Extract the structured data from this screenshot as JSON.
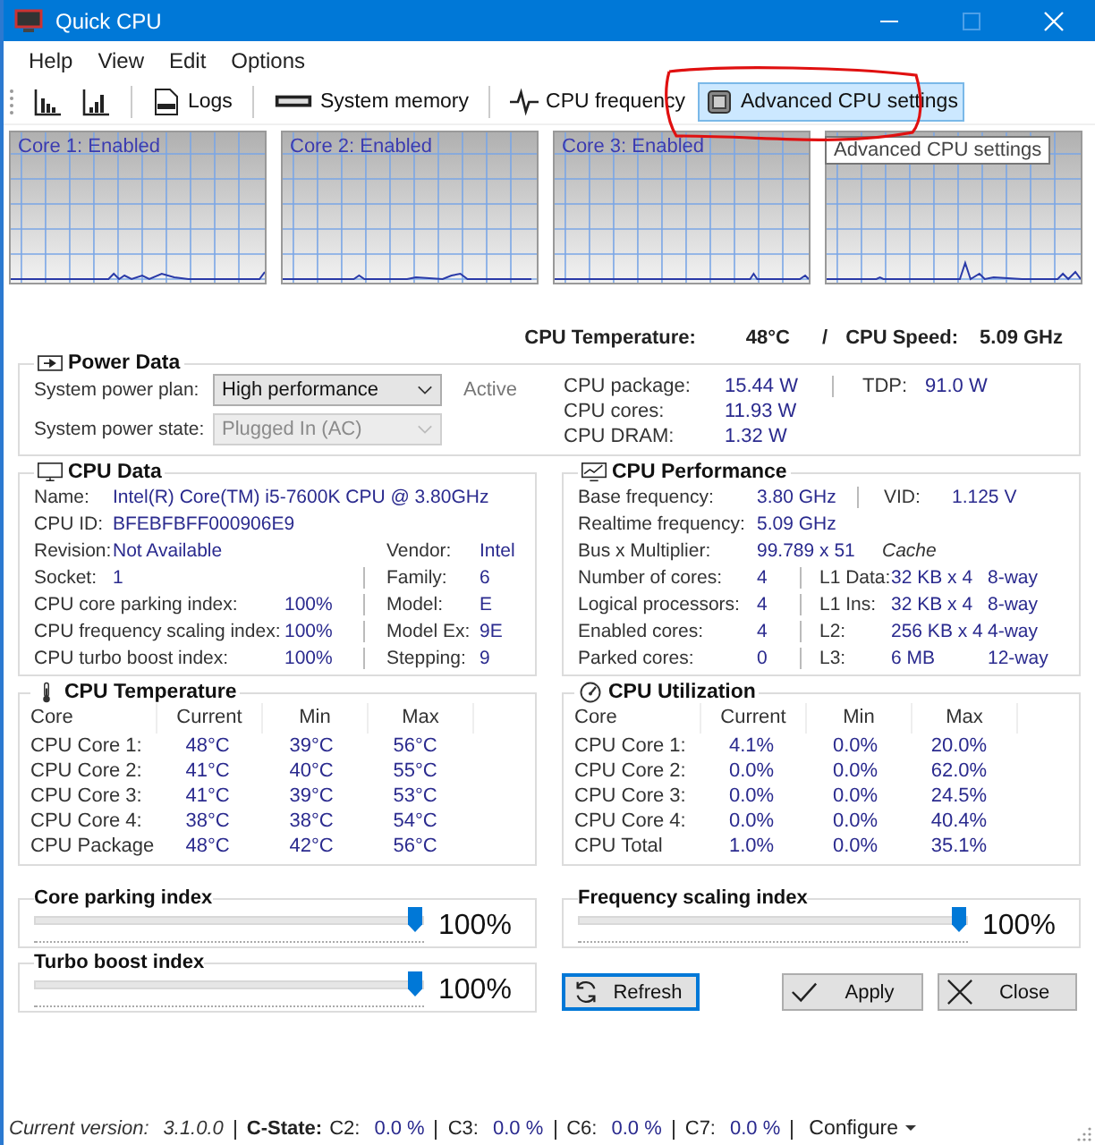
{
  "window": {
    "title": "Quick CPU"
  },
  "menu": [
    {
      "label": "Help"
    },
    {
      "label": "View"
    },
    {
      "label": "Edit"
    },
    {
      "label": "Options"
    }
  ],
  "toolbar": [
    {
      "kind": "bars",
      "selected": false
    },
    {
      "kind": "rising",
      "selected": false
    },
    {
      "kind": "sep"
    },
    {
      "kind": "log",
      "label": "Logs",
      "selected": false
    },
    {
      "kind": "sep"
    },
    {
      "kind": "memory",
      "label": "System memory",
      "selected": false
    },
    {
      "kind": "sep"
    },
    {
      "kind": "pulse",
      "label": "CPU frequency",
      "selected": false
    },
    {
      "kind": "chip",
      "label": "Advanced CPU settings",
      "selected": true
    }
  ],
  "graphs": [
    {
      "kind": "labeled",
      "label": "Core 1: Enabled"
    },
    {
      "kind": "labeled",
      "label": "Core 2: Enabled"
    },
    {
      "kind": "labeled",
      "label": "Core 3: Enabled"
    },
    {
      "kind": "plain"
    }
  ],
  "tooltip": "Advanced CPU settings",
  "summary": {
    "temperature_label": "CPU Temperature:",
    "temperature": "48°C",
    "separator": "/",
    "speed_label": "CPU Speed:",
    "speed": "5.09 GHz"
  },
  "power": {
    "title": "Power Data",
    "selects": [
      {
        "label": "System power plan:",
        "value": "High performance",
        "disabled": false,
        "status": "Active"
      },
      {
        "label": "System power state:",
        "value": "Plugged In (AC)",
        "disabled": true
      }
    ],
    "rows": [
      {
        "label": "CPU package:",
        "value": "15.44 W"
      },
      {
        "label": "CPU cores:",
        "value": "11.93 W"
      },
      {
        "label": "CPU DRAM:",
        "value": "1.32 W"
      }
    ],
    "tdp_label": "TDP:",
    "tdp": "91.0 W"
  },
  "cpu_data": {
    "title": "CPU Data",
    "rows": [
      {
        "kind": "wide",
        "label": "Name:",
        "value": "Intel(R) Core(TM) i5-7600K CPU @ 3.80GHz"
      },
      {
        "kind": "wide",
        "label": "CPU ID:",
        "value": "BFEBFBFF000906E9"
      },
      {
        "kind": "pair",
        "label": "Revision:",
        "value": "Not Available",
        "label2": "Vendor:",
        "value2": "Intel"
      },
      {
        "kind": "split",
        "label": "Socket:",
        "value": "1",
        "label2": "Family:",
        "value2": "6"
      },
      {
        "kind": "far",
        "label": "CPU core parking index:",
        "value": "100%",
        "label2": "Model:",
        "value2": "E"
      },
      {
        "kind": "far",
        "label": "CPU frequency scaling index:",
        "value": "100%",
        "label2": "Model Ex:",
        "value2": "9E"
      },
      {
        "kind": "far",
        "label": "CPU turbo boost index:",
        "value": "100%",
        "label2": "Stepping:",
        "value2": "9"
      }
    ]
  },
  "cpu_performance": {
    "title": "CPU Performance",
    "rows": [
      {
        "label": "Base frequency:",
        "value": "3.80 GHz",
        "label2": "VID:",
        "value2": "1.125 V"
      },
      {
        "label": "Realtime frequency:",
        "value": "5.09 GHz"
      },
      {
        "label": "Bus x Multiplier:",
        "value": "99.789 x 51"
      }
    ],
    "cache_title": "Cache",
    "cache_rows": [
      {
        "label": "Number of cores:",
        "value": "4",
        "cache": "L1 Data:",
        "size": "32 KB x 4",
        "ways": "8-way"
      },
      {
        "label": "Logical processors:",
        "value": "4",
        "cache": "L1 Ins:",
        "size": "32 KB x 4",
        "ways": "8-way"
      },
      {
        "label": "Enabled cores:",
        "value": "4",
        "cache": "L2:",
        "size": "256 KB x 4",
        "ways": "4-way"
      },
      {
        "label": "Parked cores:",
        "value": "0",
        "cache": "L3:",
        "size": "6 MB",
        "ways": "12-way"
      }
    ]
  },
  "temperature": {
    "title": "CPU Temperature",
    "columns": [
      "Core",
      "Current",
      "Min",
      "Max"
    ],
    "rows": [
      [
        "CPU Core 1:",
        "48°C",
        "39°C",
        "56°C"
      ],
      [
        "CPU Core 2:",
        "41°C",
        "40°C",
        "55°C"
      ],
      [
        "CPU Core 3:",
        "41°C",
        "39°C",
        "53°C"
      ],
      [
        "CPU Core 4:",
        "38°C",
        "38°C",
        "54°C"
      ],
      [
        "CPU Package",
        "48°C",
        "42°C",
        "56°C"
      ]
    ]
  },
  "utilization": {
    "title": "CPU Utilization",
    "columns": [
      "Core",
      "Current",
      "Min",
      "Max"
    ],
    "rows": [
      [
        "CPU Core 1:",
        "4.1%",
        "0.0%",
        "20.0%"
      ],
      [
        "CPU Core 2:",
        "0.0%",
        "0.0%",
        "62.0%"
      ],
      [
        "CPU Core 3:",
        "0.0%",
        "0.0%",
        "24.5%"
      ],
      [
        "CPU Core 4:",
        "0.0%",
        "0.0%",
        "40.4%"
      ],
      [
        "CPU Total",
        "1.0%",
        "0.0%",
        "35.1%"
      ]
    ]
  },
  "sliders": [
    {
      "title": "Core parking index",
      "level": 1,
      "reading": "100%"
    },
    {
      "title": "Frequency scaling index",
      "level": 1,
      "reading": "100%"
    },
    {
      "title": "Turbo boost index",
      "level": 1,
      "reading": "100%"
    }
  ],
  "buttons": [
    {
      "kind": "refresh",
      "label": "Refresh",
      "focused": true
    },
    {
      "kind": "apply",
      "label": "Apply",
      "focused": false
    },
    {
      "kind": "close",
      "label": "Close",
      "focused": false
    }
  ],
  "status": {
    "version_label": "Current version:",
    "version": "3.1.0.0",
    "cstate_label": "C-State:",
    "cstates": [
      {
        "label": "C2:",
        "value": "0.0 %"
      },
      {
        "label": "C3:",
        "value": "0.0 %"
      },
      {
        "label": "C6:",
        "value": "0.0 %"
      },
      {
        "label": "C7:",
        "value": "0.0 %"
      }
    ],
    "configure": "Configure"
  }
}
